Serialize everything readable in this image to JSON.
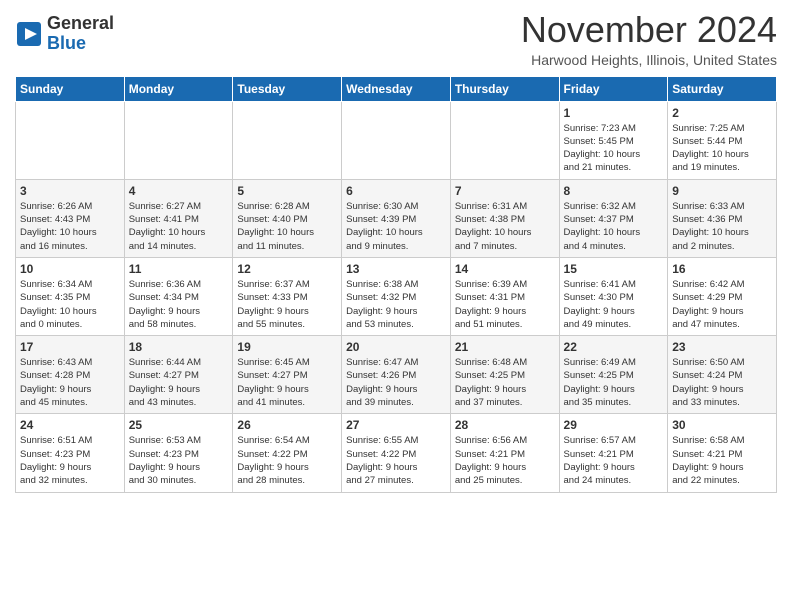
{
  "header": {
    "logo_line1": "General",
    "logo_line2": "Blue",
    "month": "November 2024",
    "location": "Harwood Heights, Illinois, United States"
  },
  "weekdays": [
    "Sunday",
    "Monday",
    "Tuesday",
    "Wednesday",
    "Thursday",
    "Friday",
    "Saturday"
  ],
  "weeks": [
    [
      {
        "day": "",
        "info": ""
      },
      {
        "day": "",
        "info": ""
      },
      {
        "day": "",
        "info": ""
      },
      {
        "day": "",
        "info": ""
      },
      {
        "day": "",
        "info": ""
      },
      {
        "day": "1",
        "info": "Sunrise: 7:23 AM\nSunset: 5:45 PM\nDaylight: 10 hours\nand 21 minutes."
      },
      {
        "day": "2",
        "info": "Sunrise: 7:25 AM\nSunset: 5:44 PM\nDaylight: 10 hours\nand 19 minutes."
      }
    ],
    [
      {
        "day": "3",
        "info": "Sunrise: 6:26 AM\nSunset: 4:43 PM\nDaylight: 10 hours\nand 16 minutes."
      },
      {
        "day": "4",
        "info": "Sunrise: 6:27 AM\nSunset: 4:41 PM\nDaylight: 10 hours\nand 14 minutes."
      },
      {
        "day": "5",
        "info": "Sunrise: 6:28 AM\nSunset: 4:40 PM\nDaylight: 10 hours\nand 11 minutes."
      },
      {
        "day": "6",
        "info": "Sunrise: 6:30 AM\nSunset: 4:39 PM\nDaylight: 10 hours\nand 9 minutes."
      },
      {
        "day": "7",
        "info": "Sunrise: 6:31 AM\nSunset: 4:38 PM\nDaylight: 10 hours\nand 7 minutes."
      },
      {
        "day": "8",
        "info": "Sunrise: 6:32 AM\nSunset: 4:37 PM\nDaylight: 10 hours\nand 4 minutes."
      },
      {
        "day": "9",
        "info": "Sunrise: 6:33 AM\nSunset: 4:36 PM\nDaylight: 10 hours\nand 2 minutes."
      }
    ],
    [
      {
        "day": "10",
        "info": "Sunrise: 6:34 AM\nSunset: 4:35 PM\nDaylight: 10 hours\nand 0 minutes."
      },
      {
        "day": "11",
        "info": "Sunrise: 6:36 AM\nSunset: 4:34 PM\nDaylight: 9 hours\nand 58 minutes."
      },
      {
        "day": "12",
        "info": "Sunrise: 6:37 AM\nSunset: 4:33 PM\nDaylight: 9 hours\nand 55 minutes."
      },
      {
        "day": "13",
        "info": "Sunrise: 6:38 AM\nSunset: 4:32 PM\nDaylight: 9 hours\nand 53 minutes."
      },
      {
        "day": "14",
        "info": "Sunrise: 6:39 AM\nSunset: 4:31 PM\nDaylight: 9 hours\nand 51 minutes."
      },
      {
        "day": "15",
        "info": "Sunrise: 6:41 AM\nSunset: 4:30 PM\nDaylight: 9 hours\nand 49 minutes."
      },
      {
        "day": "16",
        "info": "Sunrise: 6:42 AM\nSunset: 4:29 PM\nDaylight: 9 hours\nand 47 minutes."
      }
    ],
    [
      {
        "day": "17",
        "info": "Sunrise: 6:43 AM\nSunset: 4:28 PM\nDaylight: 9 hours\nand 45 minutes."
      },
      {
        "day": "18",
        "info": "Sunrise: 6:44 AM\nSunset: 4:27 PM\nDaylight: 9 hours\nand 43 minutes."
      },
      {
        "day": "19",
        "info": "Sunrise: 6:45 AM\nSunset: 4:27 PM\nDaylight: 9 hours\nand 41 minutes."
      },
      {
        "day": "20",
        "info": "Sunrise: 6:47 AM\nSunset: 4:26 PM\nDaylight: 9 hours\nand 39 minutes."
      },
      {
        "day": "21",
        "info": "Sunrise: 6:48 AM\nSunset: 4:25 PM\nDaylight: 9 hours\nand 37 minutes."
      },
      {
        "day": "22",
        "info": "Sunrise: 6:49 AM\nSunset: 4:25 PM\nDaylight: 9 hours\nand 35 minutes."
      },
      {
        "day": "23",
        "info": "Sunrise: 6:50 AM\nSunset: 4:24 PM\nDaylight: 9 hours\nand 33 minutes."
      }
    ],
    [
      {
        "day": "24",
        "info": "Sunrise: 6:51 AM\nSunset: 4:23 PM\nDaylight: 9 hours\nand 32 minutes."
      },
      {
        "day": "25",
        "info": "Sunrise: 6:53 AM\nSunset: 4:23 PM\nDaylight: 9 hours\nand 30 minutes."
      },
      {
        "day": "26",
        "info": "Sunrise: 6:54 AM\nSunset: 4:22 PM\nDaylight: 9 hours\nand 28 minutes."
      },
      {
        "day": "27",
        "info": "Sunrise: 6:55 AM\nSunset: 4:22 PM\nDaylight: 9 hours\nand 27 minutes."
      },
      {
        "day": "28",
        "info": "Sunrise: 6:56 AM\nSunset: 4:21 PM\nDaylight: 9 hours\nand 25 minutes."
      },
      {
        "day": "29",
        "info": "Sunrise: 6:57 AM\nSunset: 4:21 PM\nDaylight: 9 hours\nand 24 minutes."
      },
      {
        "day": "30",
        "info": "Sunrise: 6:58 AM\nSunset: 4:21 PM\nDaylight: 9 hours\nand 22 minutes."
      }
    ]
  ]
}
